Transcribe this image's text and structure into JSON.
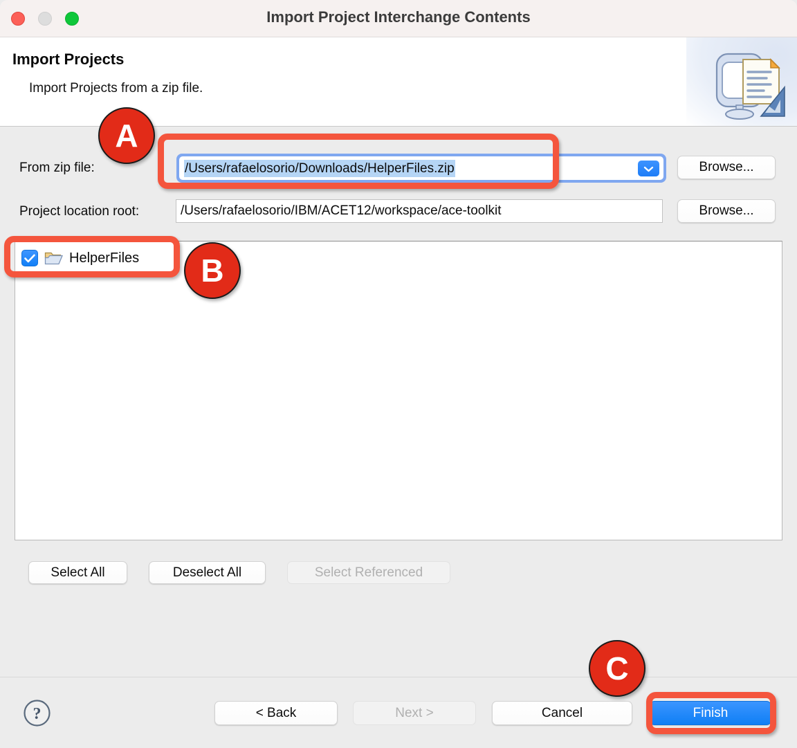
{
  "window": {
    "title": "Import Project Interchange Contents",
    "traffic_lights": [
      {
        "name": "close",
        "color": "#fc6058"
      },
      {
        "name": "minimize",
        "color": "#dddddd"
      },
      {
        "name": "maximize",
        "color": "#0fc73a"
      }
    ]
  },
  "header": {
    "title": "Import Projects",
    "description": "Import Projects from a zip file.",
    "banner_icon": "import-wizard-banner-icon"
  },
  "form": {
    "zip_label": "From zip file:",
    "zip_value": "/Users/rafaelosorio/Downloads/HelperFiles.zip",
    "zip_browse_label": "Browse...",
    "zip_dropdown_icon": "chevron-down-icon",
    "root_label": "Project location root:",
    "root_value": "/Users/rafaelosorio/IBM/ACET12/workspace/ace-toolkit",
    "root_browse_label": "Browse..."
  },
  "project_list": {
    "items": [
      {
        "label": "HelperFiles",
        "checked": true,
        "icon": "open-folder-icon"
      }
    ]
  },
  "selection_buttons": {
    "select_all": "Select All",
    "deselect_all": "Deselect All",
    "select_referenced": "Select Referenced",
    "select_referenced_disabled": true
  },
  "footer": {
    "help_icon": "help-question-icon",
    "back": "< Back",
    "next": "Next >",
    "next_disabled": true,
    "cancel": "Cancel",
    "finish": "Finish"
  },
  "annotations": {
    "colors": {
      "marker": "#e22b18",
      "box": "#f4553d"
    },
    "markers": [
      {
        "id": "A",
        "label": "A",
        "target": "zip-file-combo"
      },
      {
        "id": "B",
        "label": "B",
        "target": "project-list-item"
      },
      {
        "id": "C",
        "label": "C",
        "target": "finish-button"
      }
    ]
  }
}
